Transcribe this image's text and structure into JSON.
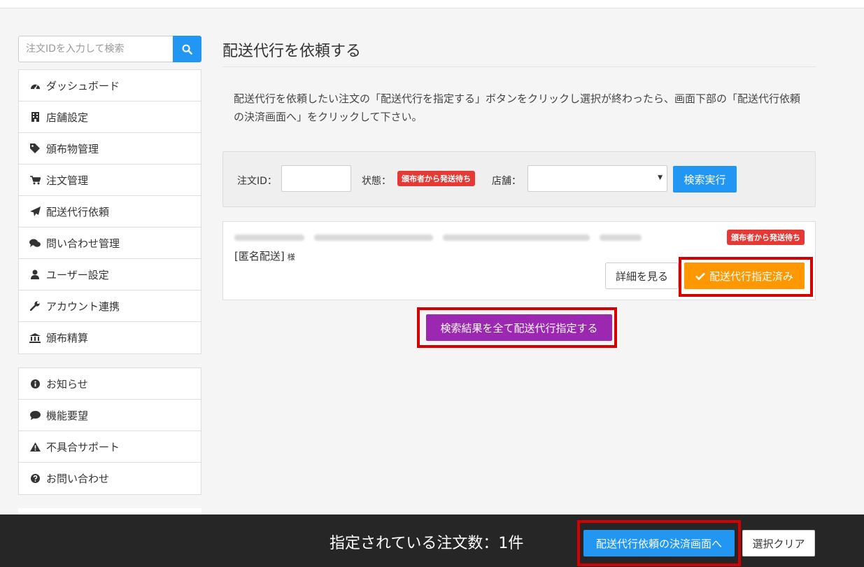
{
  "search": {
    "placeholder": "注文IDを入力して検索",
    "icon": "search-icon"
  },
  "sidebar": {
    "items": [
      {
        "label": "ダッシュボード",
        "icon": "dashboard-icon"
      },
      {
        "label": "店舗設定",
        "icon": "building-icon"
      },
      {
        "label": "頒布物管理",
        "icon": "tag-icon"
      },
      {
        "label": "注文管理",
        "icon": "cart-icon"
      },
      {
        "label": "配送代行依頼",
        "icon": "paper-plane-icon"
      },
      {
        "label": "問い合わせ管理",
        "icon": "comments-icon"
      },
      {
        "label": "ユーザー設定",
        "icon": "user-icon"
      },
      {
        "label": "アカウント連携",
        "icon": "wrench-icon"
      },
      {
        "label": "頒布精算",
        "icon": "bank-icon"
      }
    ],
    "support_items": [
      {
        "label": "お知らせ",
        "icon": "info-icon"
      },
      {
        "label": "機能要望",
        "icon": "comment-icon"
      },
      {
        "label": "不具合サポート",
        "icon": "warning-icon"
      },
      {
        "label": "お問い合わせ",
        "icon": "question-icon"
      }
    ]
  },
  "main": {
    "title": "配送代行を依頼する",
    "instruction": "配送代行を依頼したい注文の「配送代行を指定する」ボタンをクリックし選択が終わったら、画面下部の「配送代行依頼の決済画面へ」をクリックして下さい。",
    "filter": {
      "order_id_label": "注文ID：",
      "order_id_value": "",
      "status_label": "状態：",
      "status_badge": "頒布者から発送待ち",
      "store_label": "店舗：",
      "store_value": "",
      "search_button": "検索実行"
    },
    "result": {
      "status_badge": "頒布者から発送待ち",
      "recipient": "[匿名配送]",
      "honorific": "様",
      "detail_button": "詳細を見る",
      "assigned_button": "配送代行指定済み"
    },
    "assign_all_button": "検索結果を全て配送代行指定する"
  },
  "footer": {
    "count_text": "指定されている注文数：1件",
    "checkout_button": "配送代行依頼の決済画面へ",
    "clear_button": "選択クリア"
  },
  "colors": {
    "primary": "#2196f3",
    "warning": "#ff9800",
    "purple": "#9c27b0",
    "badge_red": "#e53935",
    "highlight": "#d50000",
    "footer_bg": "#262626"
  }
}
